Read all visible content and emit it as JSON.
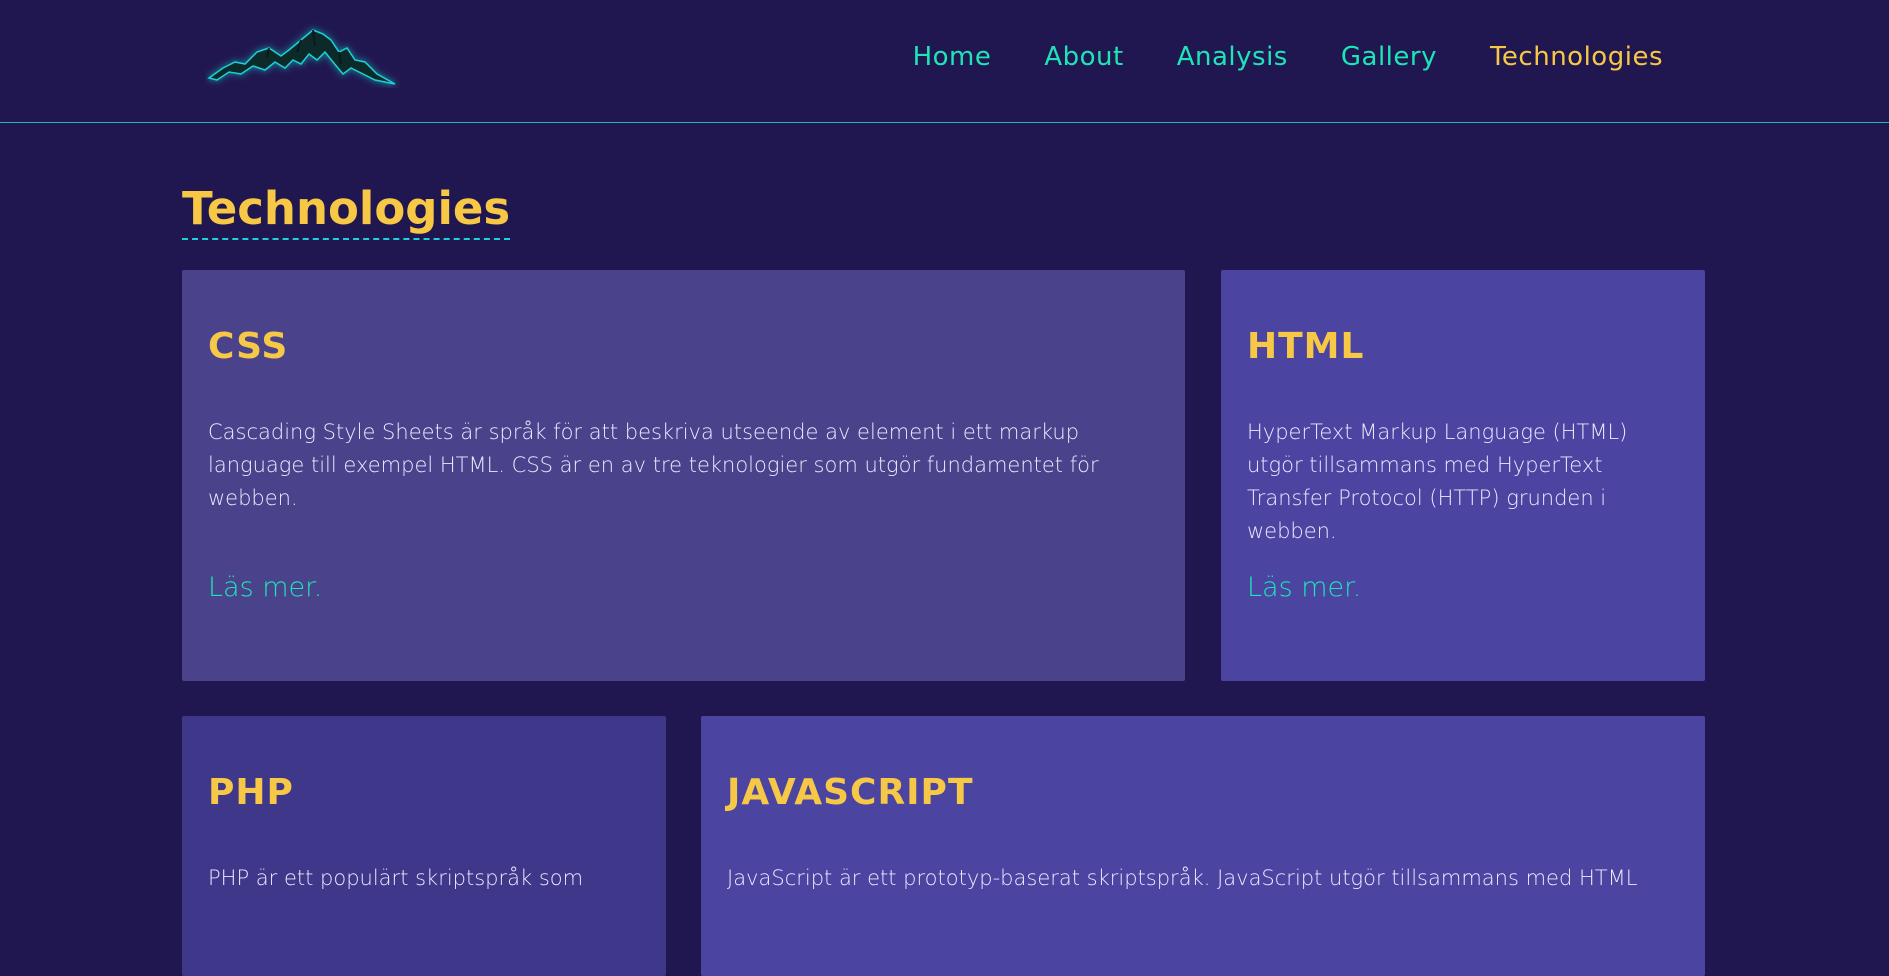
{
  "header": {
    "logo": "mountain-logo",
    "nav": [
      {
        "label": "Home"
      },
      {
        "label": "About"
      },
      {
        "label": "Analysis"
      },
      {
        "label": "Gallery"
      },
      {
        "label": "Technologies",
        "active": true
      }
    ]
  },
  "page": {
    "title": "Technologies"
  },
  "cards": [
    {
      "title": "CSS",
      "text": "Cascading Style Sheets är språk för att beskriva utseende av element i ett markup language till exempel HTML. CSS är en av tre teknologier som utgör fundamentet för webben.",
      "link": "Läs mer."
    },
    {
      "title": "HTML",
      "text": "HyperText Markup Language (HTML) utgör tillsammans med HyperText Transfer Protocol (HTTP) grunden i webben.",
      "link": "Läs mer."
    },
    {
      "title": "PHP",
      "text": "PHP är ett populärt skriptspråk som"
    },
    {
      "title": "JAVASCRIPT",
      "text": "JavaScript är ett prototyp-baserat skriptspråk. JavaScript utgör tillsammans med HTML"
    }
  ],
  "colors": {
    "background": "#211750",
    "accent_yellow": "#f7c846",
    "accent_teal": "#1de5b8",
    "divider": "#20b6c0"
  }
}
